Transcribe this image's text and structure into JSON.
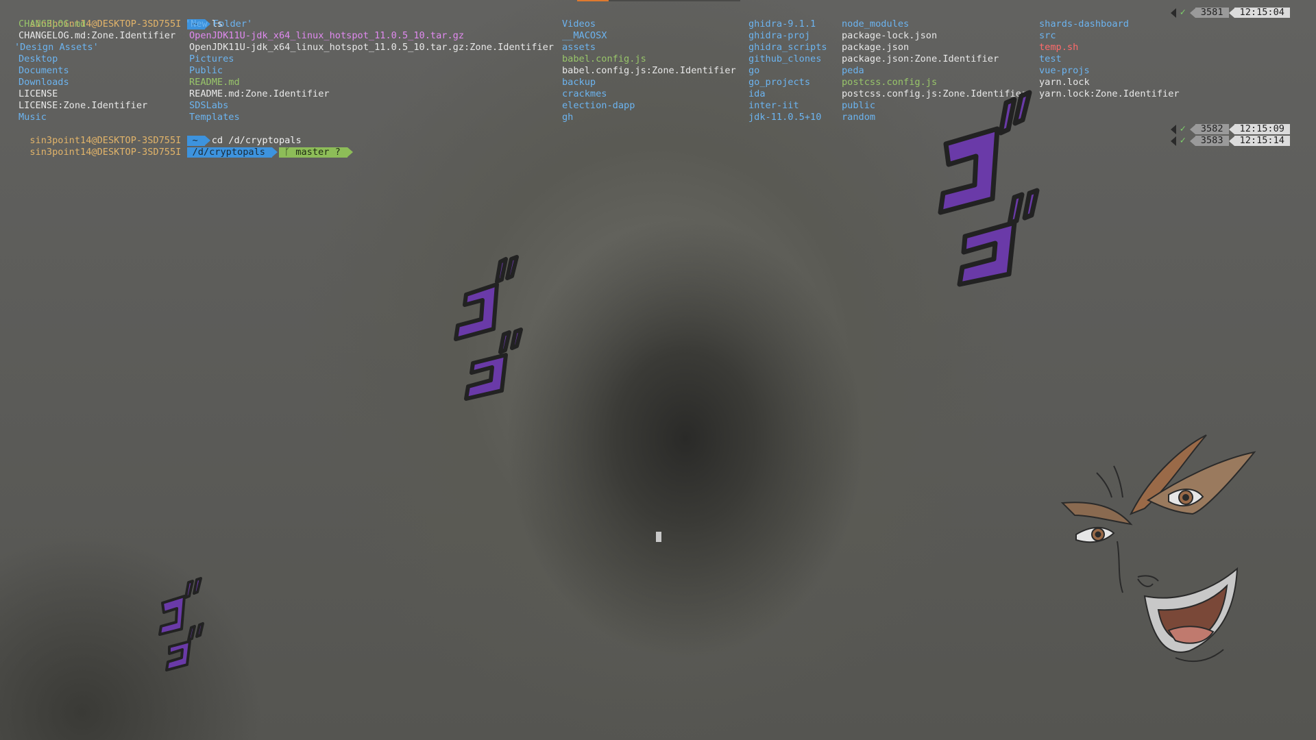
{
  "prompts": [
    {
      "user": "sin3point14@DESKTOP-3SD755I",
      "path": "~",
      "command": "ls",
      "cmd_no": "3581",
      "time": "12:15:04"
    },
    {
      "user": "sin3point14@DESKTOP-3SD755I",
      "path": "~",
      "command": "cd /d/cryptopals",
      "cmd_no": "3582",
      "time": "12:15:09"
    },
    {
      "user": "sin3point14@DESKTOP-3SD755I",
      "path": "/d/cryptopals",
      "git": "master ?",
      "cmd_no": "3583",
      "time": "12:15:14"
    }
  ],
  "status_check": "✓",
  "branch_icon": "git-branch-icon",
  "ls_columns": [
    [
      {
        "name": "CHANGELOG.md",
        "kind": "exe"
      },
      {
        "name": "CHANGELOG.md:Zone.Identifier",
        "kind": "file"
      },
      {
        "name": "'Design Assets'",
        "kind": "dir"
      },
      {
        "name": "Desktop",
        "kind": "dir"
      },
      {
        "name": "Documents",
        "kind": "dir"
      },
      {
        "name": "Downloads",
        "kind": "dir"
      },
      {
        "name": "LICENSE",
        "kind": "file"
      },
      {
        "name": "LICENSE:Zone.Identifier",
        "kind": "file"
      },
      {
        "name": "Music",
        "kind": "dir"
      }
    ],
    [
      {
        "name": "'New Folder'",
        "kind": "dir"
      },
      {
        "name": "OpenJDK11U-jdk_x64_linux_hotspot_11.0.5_10.tar.gz",
        "kind": "archive"
      },
      {
        "name": "OpenJDK11U-jdk_x64_linux_hotspot_11.0.5_10.tar.gz:Zone.Identifier",
        "kind": "file"
      },
      {
        "name": "Pictures",
        "kind": "dir"
      },
      {
        "name": "Public",
        "kind": "dir"
      },
      {
        "name": "README.md",
        "kind": "exe"
      },
      {
        "name": "README.md:Zone.Identifier",
        "kind": "file"
      },
      {
        "name": "SDSLabs",
        "kind": "dir"
      },
      {
        "name": "Templates",
        "kind": "dir"
      }
    ],
    [
      {
        "name": "Videos",
        "kind": "dir"
      },
      {
        "name": "__MACOSX",
        "kind": "dir"
      },
      {
        "name": "assets",
        "kind": "dir"
      },
      {
        "name": "babel.config.js",
        "kind": "exe"
      },
      {
        "name": "babel.config.js:Zone.Identifier",
        "kind": "file"
      },
      {
        "name": "backup",
        "kind": "dir"
      },
      {
        "name": "crackmes",
        "kind": "dir"
      },
      {
        "name": "election-dapp",
        "kind": "dir"
      },
      {
        "name": "gh",
        "kind": "dir"
      }
    ],
    [
      {
        "name": "ghidra-9.1.1",
        "kind": "dir"
      },
      {
        "name": "ghidra-proj",
        "kind": "dir"
      },
      {
        "name": "ghidra_scripts",
        "kind": "dir"
      },
      {
        "name": "github_clones",
        "kind": "dir"
      },
      {
        "name": "go",
        "kind": "dir"
      },
      {
        "name": "go_projects",
        "kind": "dir"
      },
      {
        "name": "ida",
        "kind": "dir"
      },
      {
        "name": "inter-iit",
        "kind": "dir"
      },
      {
        "name": "jdk-11.0.5+10",
        "kind": "dir"
      }
    ],
    [
      {
        "name": "node_modules",
        "kind": "dir"
      },
      {
        "name": "package-lock.json",
        "kind": "file"
      },
      {
        "name": "package.json",
        "kind": "file"
      },
      {
        "name": "package.json:Zone.Identifier",
        "kind": "file"
      },
      {
        "name": "peda",
        "kind": "dir"
      },
      {
        "name": "postcss.config.js",
        "kind": "exe"
      },
      {
        "name": "postcss.config.js:Zone.Identifier",
        "kind": "file"
      },
      {
        "name": "public",
        "kind": "dir"
      },
      {
        "name": "random",
        "kind": "dir"
      }
    ],
    [
      {
        "name": "shards-dashboard",
        "kind": "dir"
      },
      {
        "name": "src",
        "kind": "dir"
      },
      {
        "name": "temp.sh",
        "kind": "script"
      },
      {
        "name": "test",
        "kind": "dir"
      },
      {
        "name": "vue-projs",
        "kind": "dir"
      },
      {
        "name": "yarn.lock",
        "kind": "file"
      },
      {
        "name": "yarn.lock:Zone.Identifier",
        "kind": "file"
      }
    ]
  ],
  "colors": {
    "dir": "#6cb4f0",
    "exe": "#98c56a",
    "archive": "#e08aef",
    "script": "#ff6b6b",
    "file": "#e8e8e8",
    "user": "#e2b46a",
    "menacing": "#7a3fc0"
  },
  "decorations": {
    "menacing_glyph": "ゴ",
    "icons": [
      "menacing-glyph-icon",
      "dio-face-icon",
      "terminal-cursor-icon"
    ]
  }
}
